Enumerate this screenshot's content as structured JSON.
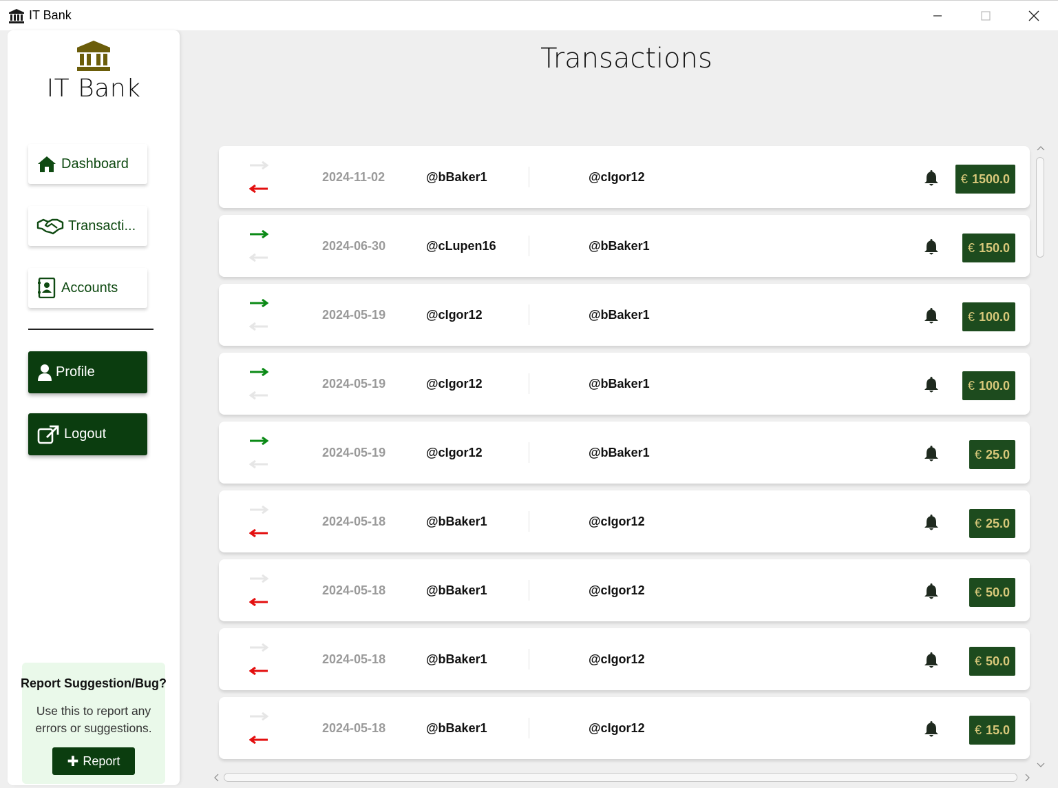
{
  "window": {
    "title": "IT Bank",
    "controls": [
      "minimize",
      "maximize",
      "close"
    ]
  },
  "sidebar": {
    "brand_name": "IT Bank",
    "nav": [
      {
        "label": "Dashboard",
        "icon": "home-icon"
      },
      {
        "label": "Transacti...",
        "icon": "handshake-icon"
      },
      {
        "label": "Accounts",
        "icon": "contact-book-icon"
      }
    ],
    "profile_label": "Profile",
    "logout_label": "Logout",
    "report": {
      "title": "Report Suggestion/Bug?",
      "description_line1": "Use this to report any",
      "description_line2": "errors or suggestions.",
      "button_label": "Report"
    }
  },
  "main": {
    "title": "Transactions",
    "currency_symbol": "€",
    "transactions": [
      {
        "direction": "outgoing",
        "date": "2024-11-02",
        "from": "@bBaker1",
        "to": "@cIgor12",
        "amount": "1500.0"
      },
      {
        "direction": "incoming",
        "date": "2024-06-30",
        "from": "@cLupen16",
        "to": "@bBaker1",
        "amount": "150.0"
      },
      {
        "direction": "incoming",
        "date": "2024-05-19",
        "from": "@cIgor12",
        "to": "@bBaker1",
        "amount": "100.0"
      },
      {
        "direction": "incoming",
        "date": "2024-05-19",
        "from": "@cIgor12",
        "to": "@bBaker1",
        "amount": "100.0"
      },
      {
        "direction": "incoming",
        "date": "2024-05-19",
        "from": "@cIgor12",
        "to": "@bBaker1",
        "amount": "25.0"
      },
      {
        "direction": "outgoing",
        "date": "2024-05-18",
        "from": "@bBaker1",
        "to": "@cIgor12",
        "amount": "25.0"
      },
      {
        "direction": "outgoing",
        "date": "2024-05-18",
        "from": "@bBaker1",
        "to": "@cIgor12",
        "amount": "50.0"
      },
      {
        "direction": "outgoing",
        "date": "2024-05-18",
        "from": "@bBaker1",
        "to": "@cIgor12",
        "amount": "50.0"
      },
      {
        "direction": "outgoing",
        "date": "2024-05-18",
        "from": "@bBaker1",
        "to": "@cIgor12",
        "amount": "15.0"
      }
    ]
  },
  "colors": {
    "brand_green": "#0b3d0f",
    "amount_bg": "#1d4b1e",
    "amount_text": "#d8c87a",
    "incoming_arrow": "#0b8a16",
    "outgoing_arrow": "#e30f0f",
    "inactive_arrow": "#e6e6e6",
    "bank_icon": "#6b5d0a"
  }
}
